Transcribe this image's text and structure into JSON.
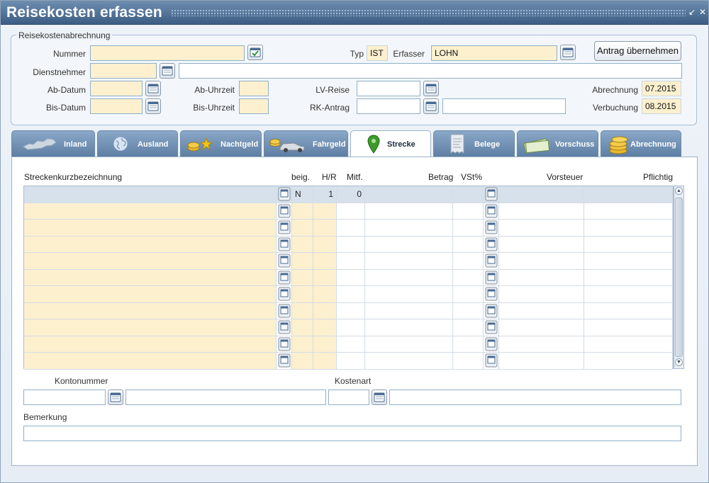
{
  "window": {
    "title": "Reisekosten erfassen",
    "minimize_icon": "minimize-icon",
    "close_icon": "close-icon"
  },
  "header": {
    "legend": "Reisekostenabrechnung",
    "nummer_label": "Nummer",
    "nummer_value": "",
    "typ_label": "Typ",
    "typ_value": "IST",
    "erfasser_label": "Erfasser",
    "erfasser_value": "LOHN",
    "dienstnehmer_label": "Dienstnehmer",
    "dienstnehmer_value": "",
    "dienstnehmer_name": "",
    "abdatum_label": "Ab-Datum",
    "abdatum_value": "",
    "abuhrzeit_label": "Ab-Uhrzeit",
    "abuhrzeit_value": "",
    "lvreise_label": "LV-Reise",
    "lvreise_value": "",
    "abrechnung_label": "Abrechnung",
    "abrechnung_value": "07.2015",
    "bisdatum_label": "Bis-Datum",
    "bisdatum_value": "",
    "bisuhrzeit_label": "Bis-Uhrzeit",
    "bisuhrzeit_value": "",
    "rkantrag_label": "RK-Antrag",
    "rkantrag_value": "",
    "rkantrag_text": "",
    "verbuchung_label": "Verbuchung",
    "verbuchung_value": "08.2015",
    "antrag_button": "Antrag übernehmen"
  },
  "tabs": [
    {
      "label": "Inland",
      "icon": "austria-map-icon"
    },
    {
      "label": "Ausland",
      "icon": "globe-icon"
    },
    {
      "label": "Nachtgeld",
      "icon": "coins-stars-icon"
    },
    {
      "label": "Fahrgeld",
      "icon": "coins-car-icon"
    },
    {
      "label": "Strecke",
      "icon": "map-pin-icon"
    },
    {
      "label": "Belege",
      "icon": "receipt-icon"
    },
    {
      "label": "Vorschuss",
      "icon": "banknotes-icon"
    },
    {
      "label": "Abrechnung",
      "icon": "coin-stack-icon"
    }
  ],
  "active_tab": "Strecke",
  "grid": {
    "columns": [
      "Streckenkurzbezeichnung",
      "beig.",
      "H/R",
      "Mitf.",
      "Betrag",
      "VSt%",
      "Vorsteuer",
      "Pflichtig"
    ],
    "rows": [
      {
        "bez": "",
        "beig": "N",
        "hr": "1",
        "mitf": "0",
        "betrag": "",
        "vst": "",
        "vorsteuer": "",
        "pflichtig": ""
      },
      {
        "bez": "",
        "beig": "",
        "hr": "",
        "mitf": "",
        "betrag": "",
        "vst": "",
        "vorsteuer": "",
        "pflichtig": ""
      },
      {
        "bez": "",
        "beig": "",
        "hr": "",
        "mitf": "",
        "betrag": "",
        "vst": "",
        "vorsteuer": "",
        "pflichtig": ""
      },
      {
        "bez": "",
        "beig": "",
        "hr": "",
        "mitf": "",
        "betrag": "",
        "vst": "",
        "vorsteuer": "",
        "pflichtig": ""
      },
      {
        "bez": "",
        "beig": "",
        "hr": "",
        "mitf": "",
        "betrag": "",
        "vst": "",
        "vorsteuer": "",
        "pflichtig": ""
      },
      {
        "bez": "",
        "beig": "",
        "hr": "",
        "mitf": "",
        "betrag": "",
        "vst": "",
        "vorsteuer": "",
        "pflichtig": ""
      },
      {
        "bez": "",
        "beig": "",
        "hr": "",
        "mitf": "",
        "betrag": "",
        "vst": "",
        "vorsteuer": "",
        "pflichtig": ""
      },
      {
        "bez": "",
        "beig": "",
        "hr": "",
        "mitf": "",
        "betrag": "",
        "vst": "",
        "vorsteuer": "",
        "pflichtig": ""
      },
      {
        "bez": "",
        "beig": "",
        "hr": "",
        "mitf": "",
        "betrag": "",
        "vst": "",
        "vorsteuer": "",
        "pflichtig": ""
      },
      {
        "bez": "",
        "beig": "",
        "hr": "",
        "mitf": "",
        "betrag": "",
        "vst": "",
        "vorsteuer": "",
        "pflichtig": ""
      },
      {
        "bez": "",
        "beig": "",
        "hr": "",
        "mitf": "",
        "betrag": "",
        "vst": "",
        "vorsteuer": "",
        "pflichtig": ""
      }
    ]
  },
  "footer": {
    "kontonummer_label": "Kontonummer",
    "kontonummer_value": "",
    "kontonummer_text": "",
    "kostenart_label": "Kostenart",
    "kostenart_value": "",
    "kostenart_text": "",
    "bemerkung_label": "Bemerkung",
    "bemerkung_value": ""
  },
  "colors": {
    "title_bar": "#4a6b93",
    "required_field": "#fdf0cf",
    "tab": "#7192b6",
    "active_tab": "#ffffff"
  }
}
